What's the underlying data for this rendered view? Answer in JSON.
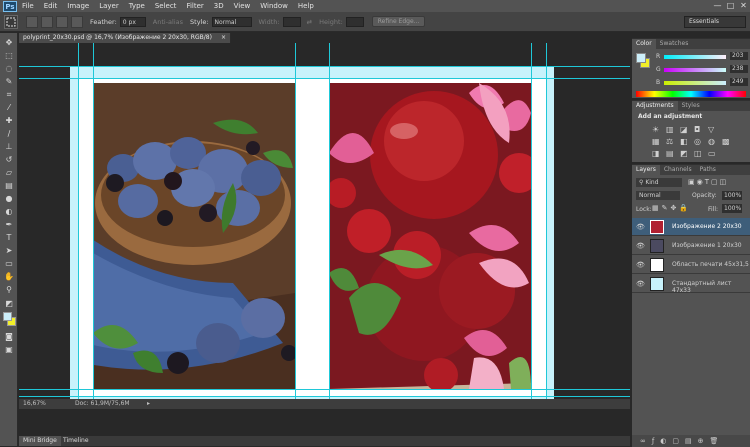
{
  "app": {
    "logo": "Ps"
  },
  "menu": [
    "File",
    "Edit",
    "Image",
    "Layer",
    "Type",
    "Select",
    "Filter",
    "3D",
    "View",
    "Window",
    "Help"
  ],
  "window_controls": [
    "—",
    "□",
    "✕"
  ],
  "options": {
    "feather_label": "Feather:",
    "feather_value": "0 px",
    "anti_alias": "Anti-alias",
    "style_label": "Style:",
    "style_value": "Normal",
    "width_label": "Width:",
    "height_label": "Height:",
    "refine_edge": "Refine Edge...",
    "workspace": "Essentials"
  },
  "document": {
    "tab_title": "polyprint_20x30.psd @ 16,7% (Изображение 2 20x30, RGB/8)",
    "zoom": "16,67%",
    "doc_info": "Doc: 61,9M/75,6M"
  },
  "bottom_tabs": [
    "Mini Bridge",
    "Timeline"
  ],
  "color_panel": {
    "tabs": [
      "Color",
      "Swatches"
    ],
    "channels": [
      {
        "label": "R",
        "value": "203",
        "pos": 0.8
      },
      {
        "label": "G",
        "value": "238",
        "pos": 0.93
      },
      {
        "label": "B",
        "value": "249",
        "pos": 0.98
      }
    ],
    "fg_color": "#cbeef9",
    "bg_color": "#f2ef2a"
  },
  "adjustments_panel": {
    "tabs": [
      "Adjustments",
      "Styles"
    ],
    "title": "Add an adjustment"
  },
  "layers_panel": {
    "tabs": [
      "Layers",
      "Channels",
      "Paths"
    ],
    "kind": "Kind",
    "blend": "Normal",
    "opacity_label": "Opacity:",
    "opacity": "100%",
    "lock_label": "Lock:",
    "fill_label": "Fill:",
    "fill": "100%",
    "layers": [
      {
        "name": "Изображение 2 20x30",
        "selected": true
      },
      {
        "name": "Изображение 1 20x30",
        "selected": false
      },
      {
        "name": "Область печати 45x31,5",
        "selected": false
      },
      {
        "name": "Стандартный лист 47x33",
        "selected": false
      }
    ]
  },
  "colors": {
    "ui_dark": "#282828",
    "panel": "#535353",
    "guide": "#1fc8d8",
    "page_border": "#c8f2fb",
    "selected_row": "#3e5e7a"
  }
}
